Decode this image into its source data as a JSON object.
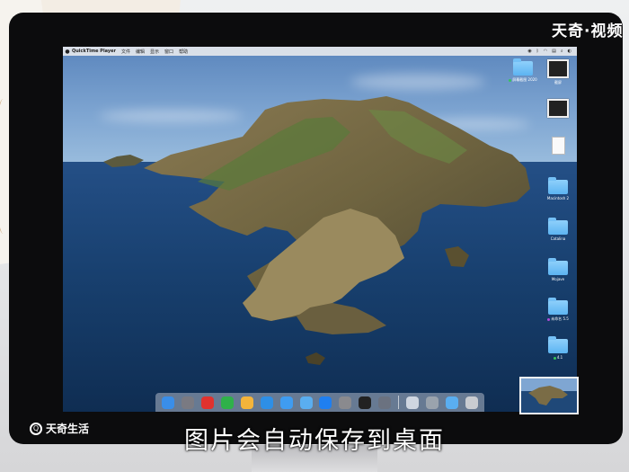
{
  "menubar": {
    "apple_icon": "apple-icon",
    "app_name": "QuickTime Player",
    "menus": [
      "文件",
      "编辑",
      "显示",
      "窗口",
      "帮助"
    ],
    "status_icons": [
      "quicktime-icon",
      "bluetooth-icon",
      "wifi-icon",
      "control-center-icon",
      "search-icon",
      "avatar-icon"
    ]
  },
  "desktop_icons": [
    {
      "name": "screenshot-folder",
      "label": "屏幕截图 2020",
      "kind": "folder"
    },
    {
      "name": "screenshot-file-1",
      "label": "截屏",
      "kind": "thumb"
    },
    {
      "name": "screenshot-file-2",
      "label": "",
      "kind": "thumb"
    },
    {
      "name": "document-file",
      "label": "",
      "kind": "doc"
    },
    {
      "name": "folder-2",
      "label": "Macintosh 2",
      "kind": "folder"
    },
    {
      "name": "folder-3",
      "label": "Catalina",
      "kind": "folder"
    },
    {
      "name": "folder-4",
      "label": "Mojave",
      "kind": "folder"
    },
    {
      "name": "folder-5",
      "label": "未命名 5.5",
      "kind": "folder"
    },
    {
      "name": "folder-6",
      "label": "4.1",
      "kind": "folder"
    }
  ],
  "dock_apps": [
    {
      "name": "finder-icon",
      "color": "#3a8ee8"
    },
    {
      "name": "launchpad-icon",
      "color": "#7a7a82"
    },
    {
      "name": "weibo-icon",
      "color": "#e0322e"
    },
    {
      "name": "wechat-icon",
      "color": "#2fb14a"
    },
    {
      "name": "photos-icon",
      "color": "#f4b43a"
    },
    {
      "name": "safari-icon",
      "color": "#2e8fe6"
    },
    {
      "name": "mail-icon",
      "color": "#3f9cf0"
    },
    {
      "name": "folder-dock-icon",
      "color": "#5aaef0"
    },
    {
      "name": "app-store-icon",
      "color": "#1f7ff0"
    },
    {
      "name": "system-prefs-icon",
      "color": "#8a8a8e"
    },
    {
      "name": "terminal-icon",
      "color": "#222222"
    },
    {
      "name": "quicktime-icon",
      "color": "#6b7280"
    },
    {
      "name": "preview-icon",
      "color": "#cfd6e0"
    },
    {
      "name": "utility-icon",
      "color": "#9aa3ad"
    },
    {
      "name": "downloads-icon",
      "color": "#5aaef0"
    },
    {
      "name": "trash-icon",
      "color": "#c9ccd1"
    }
  ],
  "watermark_top": "天奇·视频",
  "brand_logo_text": "天奇生活",
  "subtitle": "图片会自动保存到桌面"
}
